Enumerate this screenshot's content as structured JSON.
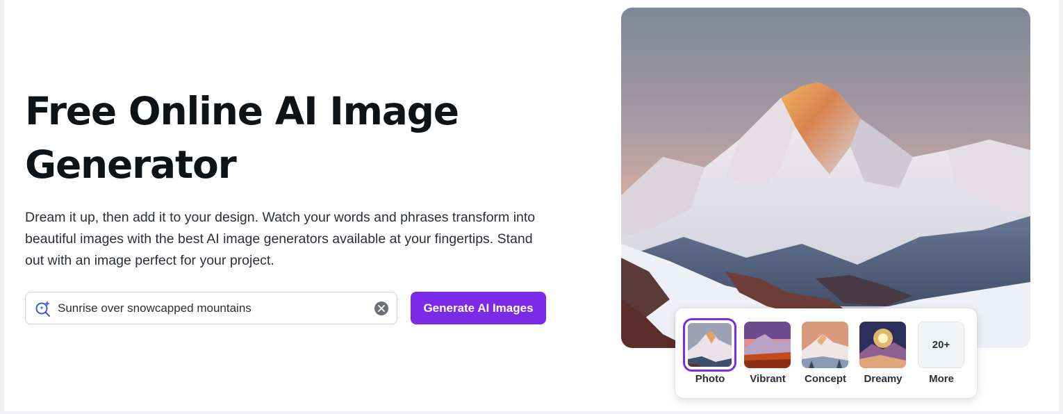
{
  "hero": {
    "title": "Free Online AI Image Generator",
    "description": "Dream it up, then add it to your design. Watch your words and phrases transform into beautiful images with the best AI image generators available at your fingertips. Stand out with an image perfect for your project."
  },
  "search": {
    "value": "Sunrise over snowcapped mountains",
    "icon": "ai-search-icon",
    "clear_icon": "clear-icon"
  },
  "generate_button": {
    "label": "Generate AI Images"
  },
  "styles": {
    "selected": "Photo",
    "items": [
      {
        "label": "Photo"
      },
      {
        "label": "Vibrant"
      },
      {
        "label": "Concept"
      },
      {
        "label": "Dreamy"
      },
      {
        "label": "More",
        "tile_text": "20+"
      }
    ]
  },
  "colors": {
    "accent": "#7d2ae8",
    "text": "#0e1318"
  }
}
